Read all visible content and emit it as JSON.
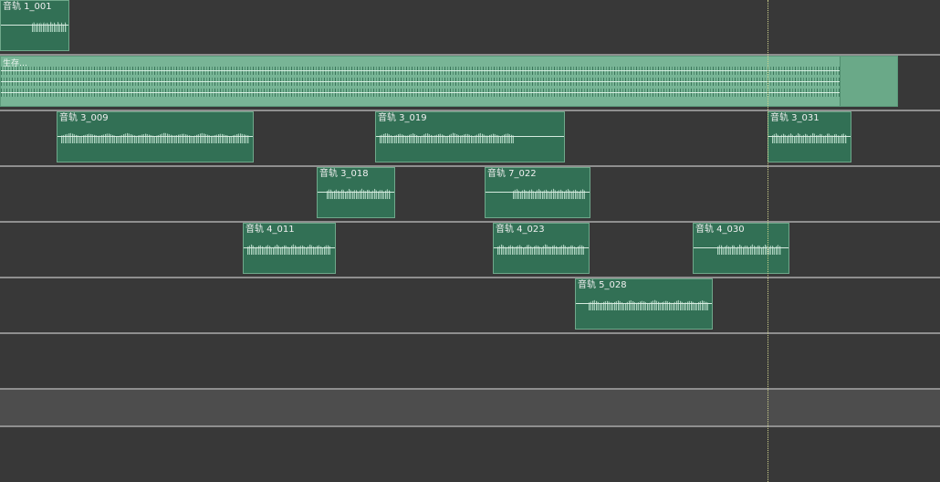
{
  "timeline": {
    "lanes": [
      {
        "clips": [
          {
            "name": "音轨 1_001"
          }
        ]
      },
      {
        "clips": [
          {
            "name": "生存…"
          }
        ]
      },
      {
        "clips": [
          {
            "name": "音轨 3_009"
          },
          {
            "name": "音轨 3_019"
          },
          {
            "name": "音轨 3_031"
          }
        ]
      },
      {
        "clips": [
          {
            "name": "音轨 3_018"
          },
          {
            "name": "音轨 7_022"
          }
        ]
      },
      {
        "clips": [
          {
            "name": "音轨 4_011"
          },
          {
            "name": "音轨 4_023"
          },
          {
            "name": "音轨 4_030"
          }
        ]
      },
      {
        "clips": [
          {
            "name": "音轨 5_028"
          }
        ]
      },
      {
        "clips": []
      },
      {
        "clips": []
      },
      {
        "clips": []
      }
    ]
  },
  "colors": {
    "background": "#383838",
    "selected_lane": "#4d4d4d",
    "clip_fill": "#327055",
    "clip_border": "#6fa88b",
    "wide_clip_fill": "#78b596",
    "lane_separator": "#8f8f8f",
    "playhead": "#ced28e"
  },
  "icons": {
    "playhead": "playhead-line"
  }
}
